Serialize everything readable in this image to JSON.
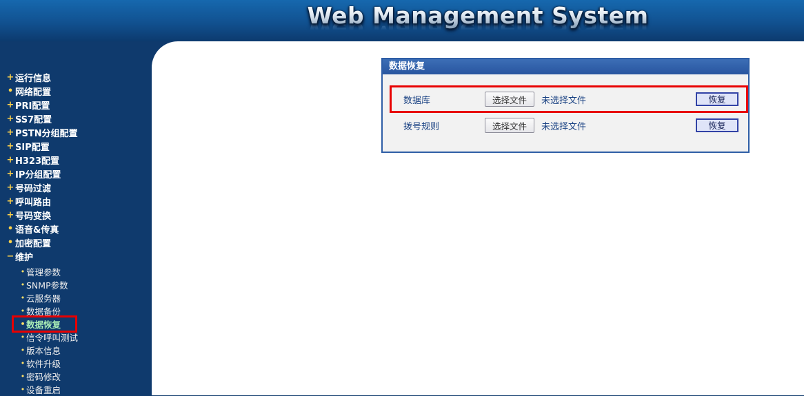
{
  "header": {
    "title": "Web Management System"
  },
  "sidebar": {
    "items": [
      {
        "bullet": "+",
        "label": "运行信息"
      },
      {
        "bullet": "•",
        "label": "网络配置"
      },
      {
        "bullet": "+",
        "label": "PRI配置"
      },
      {
        "bullet": "+",
        "label": "SS7配置"
      },
      {
        "bullet": "+",
        "label": "PSTN分组配置"
      },
      {
        "bullet": "+",
        "label": "SIP配置"
      },
      {
        "bullet": "+",
        "label": "H323配置"
      },
      {
        "bullet": "+",
        "label": "IP分组配置"
      },
      {
        "bullet": "+",
        "label": "号码过滤"
      },
      {
        "bullet": "+",
        "label": "呼叫路由"
      },
      {
        "bullet": "+",
        "label": "号码变换"
      },
      {
        "bullet": "•",
        "label": "语音&传真"
      },
      {
        "bullet": "•",
        "label": "加密配置"
      },
      {
        "bullet": "−",
        "label": "维护",
        "expanded": true
      }
    ],
    "sub_items": [
      {
        "bullet": "•",
        "label": "管理参数",
        "selected": false
      },
      {
        "bullet": "•",
        "label": "SNMP参数",
        "selected": false
      },
      {
        "bullet": "•",
        "label": "云服务器",
        "selected": false
      },
      {
        "bullet": "•",
        "label": "数据备份",
        "selected": false
      },
      {
        "bullet": "•",
        "label": "数据恢复",
        "selected": true,
        "annotated": true
      },
      {
        "bullet": "•",
        "label": "信令呼叫测试",
        "selected": false
      },
      {
        "bullet": "•",
        "label": "版本信息",
        "selected": false
      },
      {
        "bullet": "•",
        "label": "软件升级",
        "selected": false
      },
      {
        "bullet": "•",
        "label": "密码修改",
        "selected": false
      },
      {
        "bullet": "•",
        "label": "设备重启",
        "selected": false
      }
    ]
  },
  "panel": {
    "title": "数据恢复",
    "rows": [
      {
        "label": "数据库",
        "choose_button": "选择文件",
        "file_status": "未选择文件",
        "action_button": "恢复",
        "annotated": true
      },
      {
        "label": "拨号规则",
        "choose_button": "选择文件",
        "file_status": "未选择文件",
        "action_button": "恢复",
        "annotated": false
      }
    ]
  },
  "colors": {
    "sidebar_bg": "#0f3a6d",
    "header_gradient_top": "#1668ae",
    "header_gradient_bottom": "#0c3a6e",
    "panel_header_blue": "#2e5ea6",
    "panel_body_bg": "#f2f2f2",
    "annotation_red": "#e80000",
    "selected_item_green": "#a9ecb5",
    "bullet_yellow": "#ffd24a",
    "label_blue": "#1b4384",
    "restore_button_bg": "#dfe4f8",
    "restore_button_border": "#3243a6"
  }
}
